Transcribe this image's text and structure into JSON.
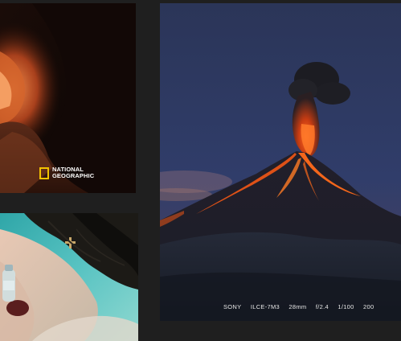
{
  "gallery": {
    "canyon_photo": {
      "logo": {
        "line1": "NATIONAL",
        "line2": "GEOGRAPHIC",
        "mark_color": "#f2c200"
      }
    },
    "volcano_photo": {
      "exif": {
        "make": "SONY",
        "model": "ILCE-7M3",
        "focal_length": "28mm",
        "aperture": "f/2.4",
        "shutter": "1/100",
        "iso": "200"
      }
    },
    "portrait_photo": {}
  },
  "colors": {
    "background": "#1f1f1f",
    "lava": "#ff5a1a",
    "sky": "#2c3a63"
  }
}
